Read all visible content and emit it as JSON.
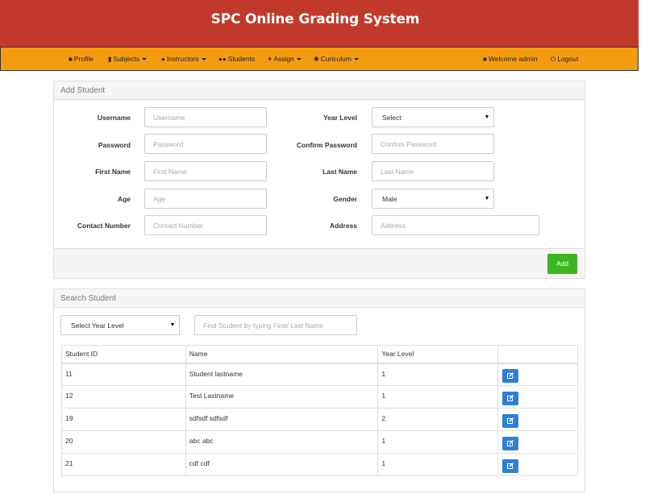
{
  "app": {
    "title": "SPC Online Grading System"
  },
  "nav": {
    "profile": "Profile",
    "subjects": "Subjects",
    "instructors": "Instructors",
    "students": "Students",
    "assign": "Assign",
    "curiculum": "Curiculum",
    "welcome": "Welcome admin",
    "logout": "Logout"
  },
  "add_student": {
    "heading": "Add Student",
    "username_label": "Username",
    "username_placeholder": "Username",
    "password_label": "Password",
    "password_placeholder": "Password",
    "firstname_label": "First Name",
    "firstname_placeholder": "First Name",
    "age_label": "Age",
    "age_placeholder": "Age",
    "contact_label": "Contact Number",
    "contact_placeholder": "Contact Number",
    "yearlevel_label": "Year Level",
    "yearlevel_value": "Select",
    "confirm_label": "Confirm Password",
    "confirm_placeholder": "Confirm Password",
    "lastname_label": "Last Name",
    "lastname_placeholder": "Last Name",
    "gender_label": "Gender",
    "gender_value": "Male",
    "address_label": "Address",
    "address_placeholder": "Address",
    "add_button": "Add"
  },
  "search_student": {
    "heading": "Search Student",
    "yearlevel_select": "Select Year Level",
    "search_placeholder": "Find Student by typing First/ Last Name",
    "columns": [
      "Student ID",
      "Name",
      "Year Level",
      ""
    ],
    "rows": [
      {
        "id": "11",
        "name": "Student lastname",
        "year": "1"
      },
      {
        "id": "12",
        "name": "Test Lastname",
        "year": "1"
      },
      {
        "id": "19",
        "name": "sdfsdf sdfsdf",
        "year": "2"
      },
      {
        "id": "20",
        "name": "abc abc",
        "year": "1"
      },
      {
        "id": "21",
        "name": "cdf cdf",
        "year": "1"
      }
    ]
  },
  "colors": {
    "header_bg": "#c0392b",
    "nav_bg": "#f39c12",
    "add_button": "#3cb521",
    "edit_button": "#2d7fd7"
  },
  "icons": {
    "profile": "user-icon",
    "subjects": "book-icon",
    "instructors": "person-icon",
    "students": "users-icon",
    "assign": "plus-icon",
    "curiculum": "gear-icon",
    "welcome": "user-icon",
    "logout": "power-icon",
    "edit": "edit-icon"
  }
}
